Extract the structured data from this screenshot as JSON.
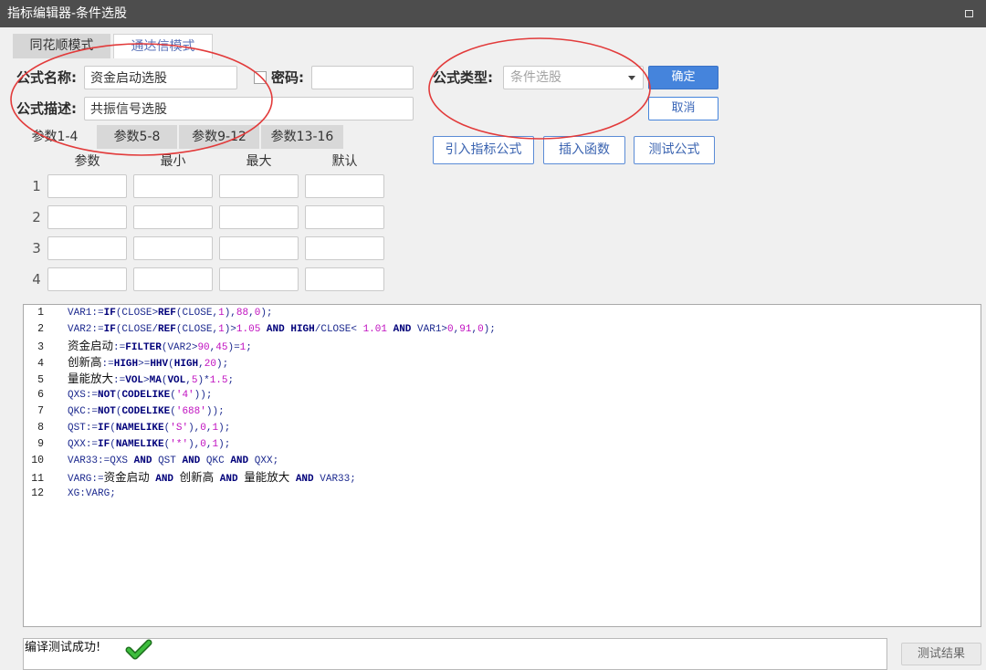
{
  "window": {
    "title": "指标编辑器-条件选股",
    "maximize_icon": "maximize-icon"
  },
  "mode_tabs": [
    {
      "label": "同花顺模式",
      "active": false
    },
    {
      "label": "通达信模式",
      "active": true
    }
  ],
  "form": {
    "name_label": "公式名称:",
    "name_value": "资金启动选股",
    "password_checkbox_checked": false,
    "password_label": "密码:",
    "password_value": "",
    "type_label": "公式类型:",
    "type_value": "条件选股",
    "type_arrow_icon": "dropdown-arrow-icon",
    "desc_label": "公式描述:",
    "desc_value": "共振信号选股"
  },
  "actions": {
    "ok_label": "确定",
    "cancel_label": "取消"
  },
  "param_tabs": [
    {
      "label": "参数1-4",
      "active": true
    },
    {
      "label": "参数5-8",
      "active": false
    },
    {
      "label": "参数9-12",
      "active": false
    },
    {
      "label": "参数13-16",
      "active": false
    }
  ],
  "tools": {
    "import_label": "引入指标公式",
    "insert_label": "插入函数",
    "test_label": "测试公式"
  },
  "params": {
    "headers": {
      "name": "参数",
      "min": "最小",
      "max": "最大",
      "default": "默认"
    },
    "rows": [
      {
        "num": "1",
        "name": "",
        "min": "",
        "max": "",
        "default": ""
      },
      {
        "num": "2",
        "name": "",
        "min": "",
        "max": "",
        "default": ""
      },
      {
        "num": "3",
        "name": "",
        "min": "",
        "max": "",
        "default": ""
      },
      {
        "num": "4",
        "name": "",
        "min": "",
        "max": "",
        "default": ""
      }
    ]
  },
  "editor": {
    "lines": [
      {
        "num": "1",
        "code": "VAR1:=IF(CLOSE>REF(CLOSE,1),88,0);"
      },
      {
        "num": "2",
        "code": "VAR2:=IF(CLOSE/REF(CLOSE,1)>1.05 AND HIGH/CLOSE< 1.01 AND VAR1>0,91,0);"
      },
      {
        "num": "3",
        "code": "资金启动:=FILTER(VAR2>90,45)=1;"
      },
      {
        "num": "4",
        "code": "创新高:=HIGH>=HHV(HIGH,20);"
      },
      {
        "num": "5",
        "code": "量能放大:=VOL>MA(VOL,5)*1.5;"
      },
      {
        "num": "6",
        "code": "QXS:=NOT(CODELIKE('4'));"
      },
      {
        "num": "7",
        "code": "QKC:=NOT(CODELIKE('688'));"
      },
      {
        "num": "8",
        "code": "QST:=IF(NAMELIKE('S'),0,1);"
      },
      {
        "num": "9",
        "code": "QXX:=IF(NAMELIKE('*'),0,1);"
      },
      {
        "num": "10",
        "code": "VAR33:=QXS AND QST AND QKC AND QXX;"
      },
      {
        "num": "11",
        "code": "VARG:=资金启动 AND 创新高 AND 量能放大 AND VAR33;"
      },
      {
        "num": "12",
        "code": "XG:VARG;"
      }
    ]
  },
  "status": {
    "message": "编译测试成功!",
    "icon": "check-success-icon",
    "result_label": "测试结果"
  },
  "colors": {
    "title_bar": "#4d4d4d",
    "accent": "#4584dc",
    "annotation": "#e23b3b",
    "identifier": "#1d2a8f",
    "keyword": "#00007a",
    "number": "#c010c0",
    "success": "#3dbd3d"
  }
}
